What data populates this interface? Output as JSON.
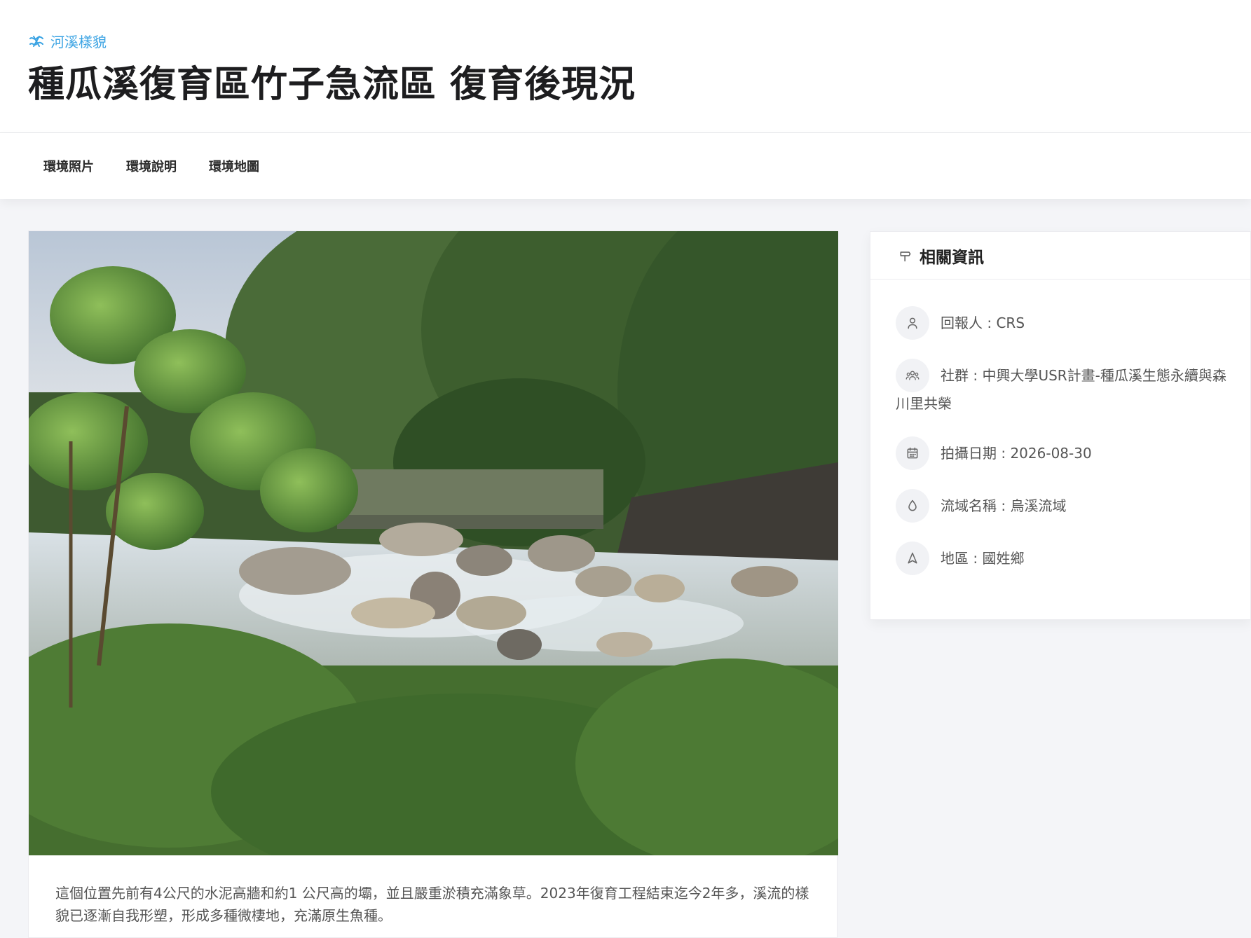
{
  "header": {
    "category": "河溪樣貌",
    "title": "種瓜溪復育區竹子急流區 復育後現況"
  },
  "tabs": [
    {
      "label": "環境照片"
    },
    {
      "label": "環境說明"
    },
    {
      "label": "環境地圖"
    }
  ],
  "main": {
    "description": "這個位置先前有4公尺的水泥高牆和約1 公尺高的壩，並且嚴重淤積充滿象草。2023年復育工程結束迄今2年多，溪流的樣貌已逐漸自我形塑，形成多種微棲地，充滿原生魚種。"
  },
  "sidebar": {
    "title": "相關資訊",
    "items": [
      {
        "text": "回報人 : CRS",
        "icon": "user-icon"
      },
      {
        "text": "社群 : 中興大學USR計畫-種瓜溪生態永續與森川里共榮",
        "icon": "group-icon"
      },
      {
        "text": "拍攝日期 : 2026-08-30",
        "icon": "calendar-icon"
      },
      {
        "text": "流域名稱 : 烏溪流域",
        "icon": "drop-icon"
      },
      {
        "text": "地區 : 國姓鄉",
        "icon": "location-icon"
      }
    ]
  },
  "colors": {
    "accent": "#3aa3e3",
    "background": "#f4f5f8"
  }
}
